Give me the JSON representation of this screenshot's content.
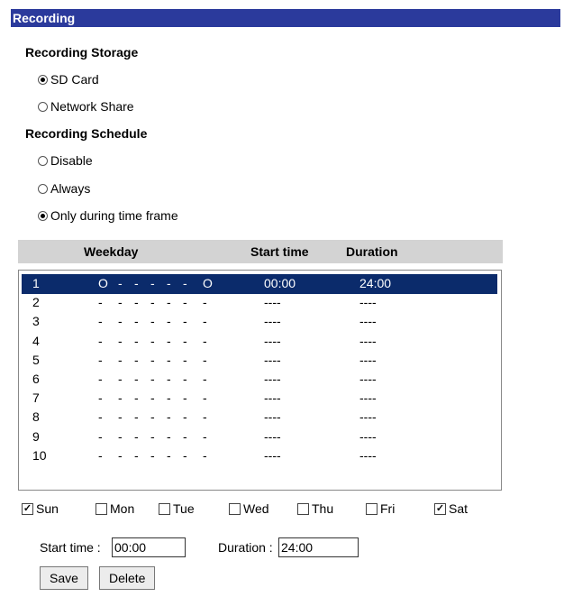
{
  "header": {
    "title": "Recording"
  },
  "storage": {
    "heading": "Recording Storage",
    "options": [
      {
        "label": "SD Card",
        "checked": true
      },
      {
        "label": "Network Share",
        "checked": false
      }
    ]
  },
  "schedule": {
    "heading": "Recording Schedule",
    "options": [
      {
        "label": "Disable",
        "checked": false
      },
      {
        "label": "Always",
        "checked": false
      },
      {
        "label": "Only during time frame",
        "checked": true
      }
    ]
  },
  "table": {
    "headers": {
      "weekday": "Weekday",
      "start": "Start time",
      "duration": "Duration"
    },
    "rows": [
      {
        "num": "1",
        "days": [
          "O",
          "-",
          "-",
          "-",
          "-",
          "-",
          "O"
        ],
        "start": "00:00",
        "duration": "24:00",
        "selected": true
      },
      {
        "num": "2",
        "days": [
          "-",
          "-",
          "-",
          "-",
          "-",
          "-",
          "-"
        ],
        "start": "----",
        "duration": "----",
        "selected": false
      },
      {
        "num": "3",
        "days": [
          "-",
          "-",
          "-",
          "-",
          "-",
          "-",
          "-"
        ],
        "start": "----",
        "duration": "----",
        "selected": false
      },
      {
        "num": "4",
        "days": [
          "-",
          "-",
          "-",
          "-",
          "-",
          "-",
          "-"
        ],
        "start": "----",
        "duration": "----",
        "selected": false
      },
      {
        "num": "5",
        "days": [
          "-",
          "-",
          "-",
          "-",
          "-",
          "-",
          "-"
        ],
        "start": "----",
        "duration": "----",
        "selected": false
      },
      {
        "num": "6",
        "days": [
          "-",
          "-",
          "-",
          "-",
          "-",
          "-",
          "-"
        ],
        "start": "----",
        "duration": "----",
        "selected": false
      },
      {
        "num": "7",
        "days": [
          "-",
          "-",
          "-",
          "-",
          "-",
          "-",
          "-"
        ],
        "start": "----",
        "duration": "----",
        "selected": false
      },
      {
        "num": "8",
        "days": [
          "-",
          "-",
          "-",
          "-",
          "-",
          "-",
          "-"
        ],
        "start": "----",
        "duration": "----",
        "selected": false
      },
      {
        "num": "9",
        "days": [
          "-",
          "-",
          "-",
          "-",
          "-",
          "-",
          "-"
        ],
        "start": "----",
        "duration": "----",
        "selected": false
      },
      {
        "num": "10",
        "days": [
          "-",
          "-",
          "-",
          "-",
          "-",
          "-",
          "-"
        ],
        "start": "----",
        "duration": "----",
        "selected": false
      }
    ]
  },
  "days": [
    {
      "label": "Sun",
      "checked": true
    },
    {
      "label": "Mon",
      "checked": false
    },
    {
      "label": "Tue",
      "checked": false
    },
    {
      "label": "Wed",
      "checked": false
    },
    {
      "label": "Thu",
      "checked": false
    },
    {
      "label": "Fri",
      "checked": false
    },
    {
      "label": "Sat",
      "checked": true
    }
  ],
  "form": {
    "start_label": "Start time :",
    "start_value": "00:00",
    "duration_label": "Duration :",
    "duration_value": "24:00"
  },
  "buttons": {
    "save": "Save",
    "delete": "Delete"
  },
  "colors": {
    "title_bar": "#2b3a9c",
    "selected_row": "#0b2b6b",
    "table_header": "#d3d3d3"
  }
}
